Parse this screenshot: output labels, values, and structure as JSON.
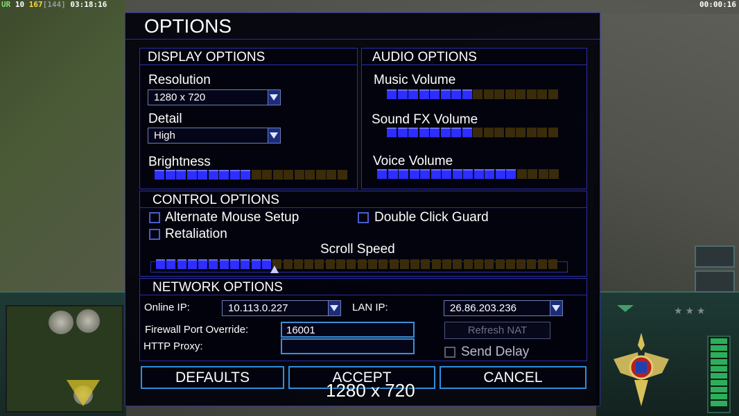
{
  "hud": {
    "faction": "UR",
    "level": "10",
    "money": "167",
    "money_max": "[144]",
    "clock_left": "03:18:16",
    "clock_right": "00:00:16"
  },
  "options": {
    "title": "OPTIONS",
    "display": {
      "header": "DISPLAY OPTIONS",
      "resolution_label": "Resolution",
      "resolution_value": "1280 x 720",
      "detail_label": "Detail",
      "detail_value": "High",
      "brightness_label": "Brightness",
      "brightness_level": 0.5
    },
    "audio": {
      "header": "AUDIO OPTIONS",
      "music_label": "Music Volume",
      "music_level": 0.5,
      "sfx_label": "Sound FX Volume",
      "sfx_level": 0.5,
      "voice_label": "Voice Volume",
      "voice_level": 0.75
    },
    "control": {
      "header": "CONTROL OPTIONS",
      "alt_mouse_label": "Alternate Mouse Setup",
      "alt_mouse_checked": false,
      "double_click_label": "Double Click Guard",
      "double_click_checked": false,
      "retaliation_label": "Retaliation",
      "retaliation_checked": false,
      "scroll_label": "Scroll Speed",
      "scroll_level": 0.3
    },
    "network": {
      "header": "NETWORK OPTIONS",
      "online_ip_label": "Online IP:",
      "online_ip_value": "10.113.0.227",
      "lan_ip_label": "LAN IP:",
      "lan_ip_value": "26.86.203.236",
      "firewall_label": "Firewall Port Override:",
      "firewall_value": "16001",
      "proxy_label": "HTTP Proxy:",
      "proxy_value": "",
      "refresh_nat_label": "Refresh NAT",
      "send_delay_label": "Send Delay",
      "send_delay_checked": false
    },
    "buttons": {
      "defaults": "DEFAULTS",
      "accept": "ACCEPT",
      "cancel": "CANCEL"
    }
  },
  "overlay": {
    "resolution_popup": "1280 x 720"
  },
  "colors": {
    "panel_border": "#2a2fa6",
    "bar_on": "#2d2eff",
    "bar_off": "#3a2c0a",
    "button_border": "#2f8fe0"
  }
}
